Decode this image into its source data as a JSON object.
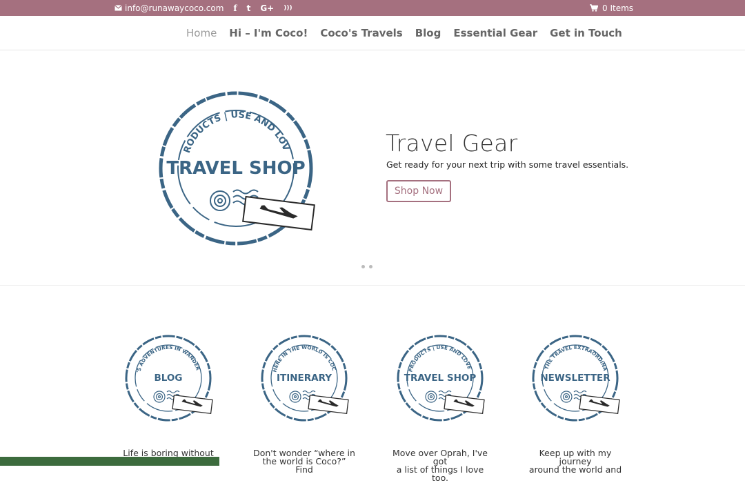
{
  "topbar": {
    "email": "info@runawaycoco.com",
    "cart": "0 Items",
    "social": [
      "facebook-icon",
      "twitter-icon",
      "google-plus-icon",
      "rss-icon"
    ],
    "social_glyphs": [
      "f",
      "t",
      "G+",
      ")))"
    ]
  },
  "nav": {
    "items": [
      "Home",
      "Hi – I'm Coco!",
      "Coco's Travels",
      "Blog",
      "Essential Gear",
      "Get in Touch"
    ]
  },
  "slider": {
    "stamp_arc": "PRODUCTS | USE AND LOVE",
    "stamp_center": "TRAVEL SHOP",
    "title": "Travel Gear",
    "description": "Get ready for your next trip with some travel essentials.",
    "button": "Shop Now"
  },
  "features": [
    {
      "arc": "COCO'S ADVENTURES IN WANDERLAND",
      "center": "BLOG",
      "text_line1": "Life is boring without",
      "text_line2": ""
    },
    {
      "arc": "WHERE IN THE WORLD IS COCO",
      "center": "ITINERARY",
      "text_line1": "Don't wonder “where in",
      "text_line2": "the world is Coco?” Find"
    },
    {
      "arc": "PRODUCTS | USE AND LOVE",
      "center": "TRAVEL SHOP",
      "text_line1": "Move over Oprah, I've got",
      "text_line2": "a list of things I love too."
    },
    {
      "arc": "FOR THE TRAVEL EXTRAORDINAIRE",
      "center": "NEWSLETTER",
      "text_line1": "Keep up with my journey",
      "text_line2": "around the world and"
    }
  ],
  "colors": {
    "brand": "#a5707f",
    "stamp": "#3b6585"
  }
}
